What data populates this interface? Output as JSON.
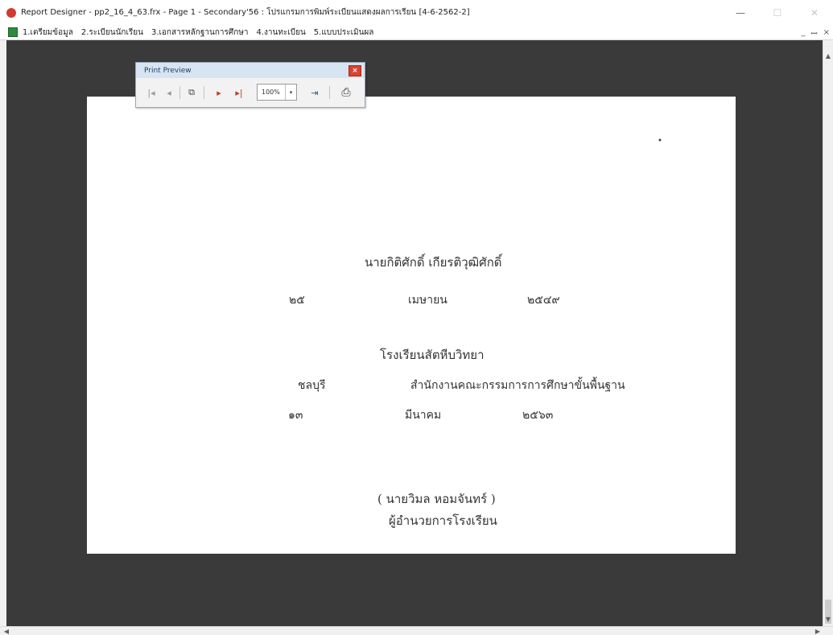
{
  "window": {
    "title": "Report Designer - pp2_16_4_63.frx - Page 1 - Secondary'56 : โปรแกรมการพิมพ์ระเบียนแสดงผลการเรียน [4-6-2562-2]",
    "controls": {
      "minimize": "—",
      "maximize": "☐",
      "close": "✕"
    }
  },
  "menu": {
    "items": [
      "1.เตรียมข้อมูล",
      "2.ระเบียนนักเรียน",
      "3.เอกสารหลักฐานการศึกษา",
      "4.งานทะเบียน",
      "5.แบบประเมินผล"
    ],
    "mdi_controls": {
      "minimize": "_",
      "restore": "ꟷ",
      "close": "×"
    }
  },
  "preview": {
    "title": "Print Preview",
    "close": "×",
    "buttons": {
      "first": "|◂",
      "prev": "◂",
      "copy": "⧉",
      "next": "▸",
      "last": "▸|",
      "exit": "⇥",
      "print": "⎙"
    },
    "zoom": "100%",
    "zoom_arrow": "▾"
  },
  "report": {
    "dot": "•",
    "name": "นายกิติศักดิ์ เกียรติวุฒิศักดิ์",
    "date1": {
      "day": "๒๕",
      "month": "เมษายน",
      "year": "๒๕๔๙"
    },
    "school": "โรงเรียนสัตหีบวิทยา",
    "province": "ชลบุรี",
    "office": "สำนักงานคณะกรรมการการศึกษาขั้นพื้นฐาน",
    "date2": {
      "day": "๑๓",
      "month": "มีนาคม",
      "year": "๒๕๖๓"
    },
    "signer_name": "( นายวิมล หอมจันทร์ )",
    "signer_position": "ผู้อำนวยการโรงเรียน"
  },
  "scroll": {
    "up": "▲",
    "down": "▼",
    "left": "◀",
    "right": "▶"
  },
  "colors": {
    "workspace": "#3a3a3a",
    "page": "#ffffff",
    "preview_title_bg": "#d7e4f2",
    "close_red": "#d9412e",
    "nav_red": "#c0392b",
    "nav_gray": "#9a9a9a"
  }
}
